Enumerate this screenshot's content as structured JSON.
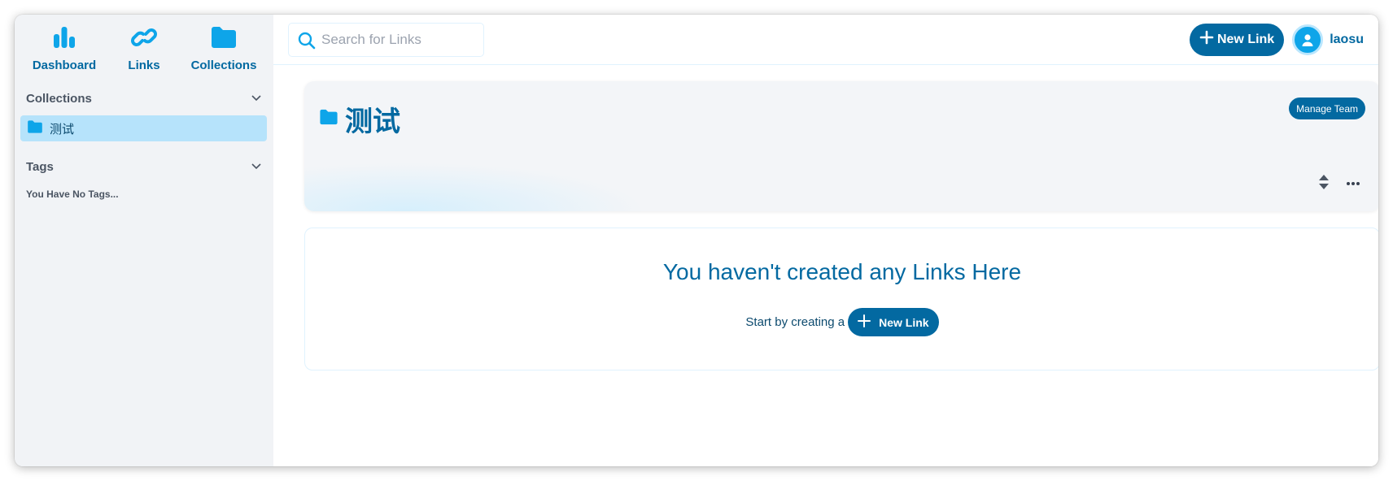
{
  "colors": {
    "accent": "#0369a1",
    "sky": "#0ea5e9",
    "selected_bg": "#b6e3fb",
    "sidebar_bg": "#f1f3f6"
  },
  "nav": {
    "items": [
      {
        "label": "Dashboard",
        "icon": "bar-chart-icon"
      },
      {
        "label": "Links",
        "icon": "link-icon"
      },
      {
        "label": "Collections",
        "icon": "folder-icon"
      }
    ]
  },
  "sidebar": {
    "collections_heading": "Collections",
    "collections": [
      {
        "name": "测试",
        "icon": "folder-icon",
        "selected": true
      }
    ],
    "tags_heading": "Tags",
    "no_tags_text": "You Have No Tags..."
  },
  "header": {
    "search_placeholder": "Search for Links",
    "new_link_label": "New Link",
    "username": "laosu"
  },
  "collection": {
    "title": "测试",
    "manage_team_label": "Manage Team"
  },
  "empty_state": {
    "title": "You haven't created any Links Here",
    "prompt": "Start by creating a",
    "button_label": "New Link"
  }
}
